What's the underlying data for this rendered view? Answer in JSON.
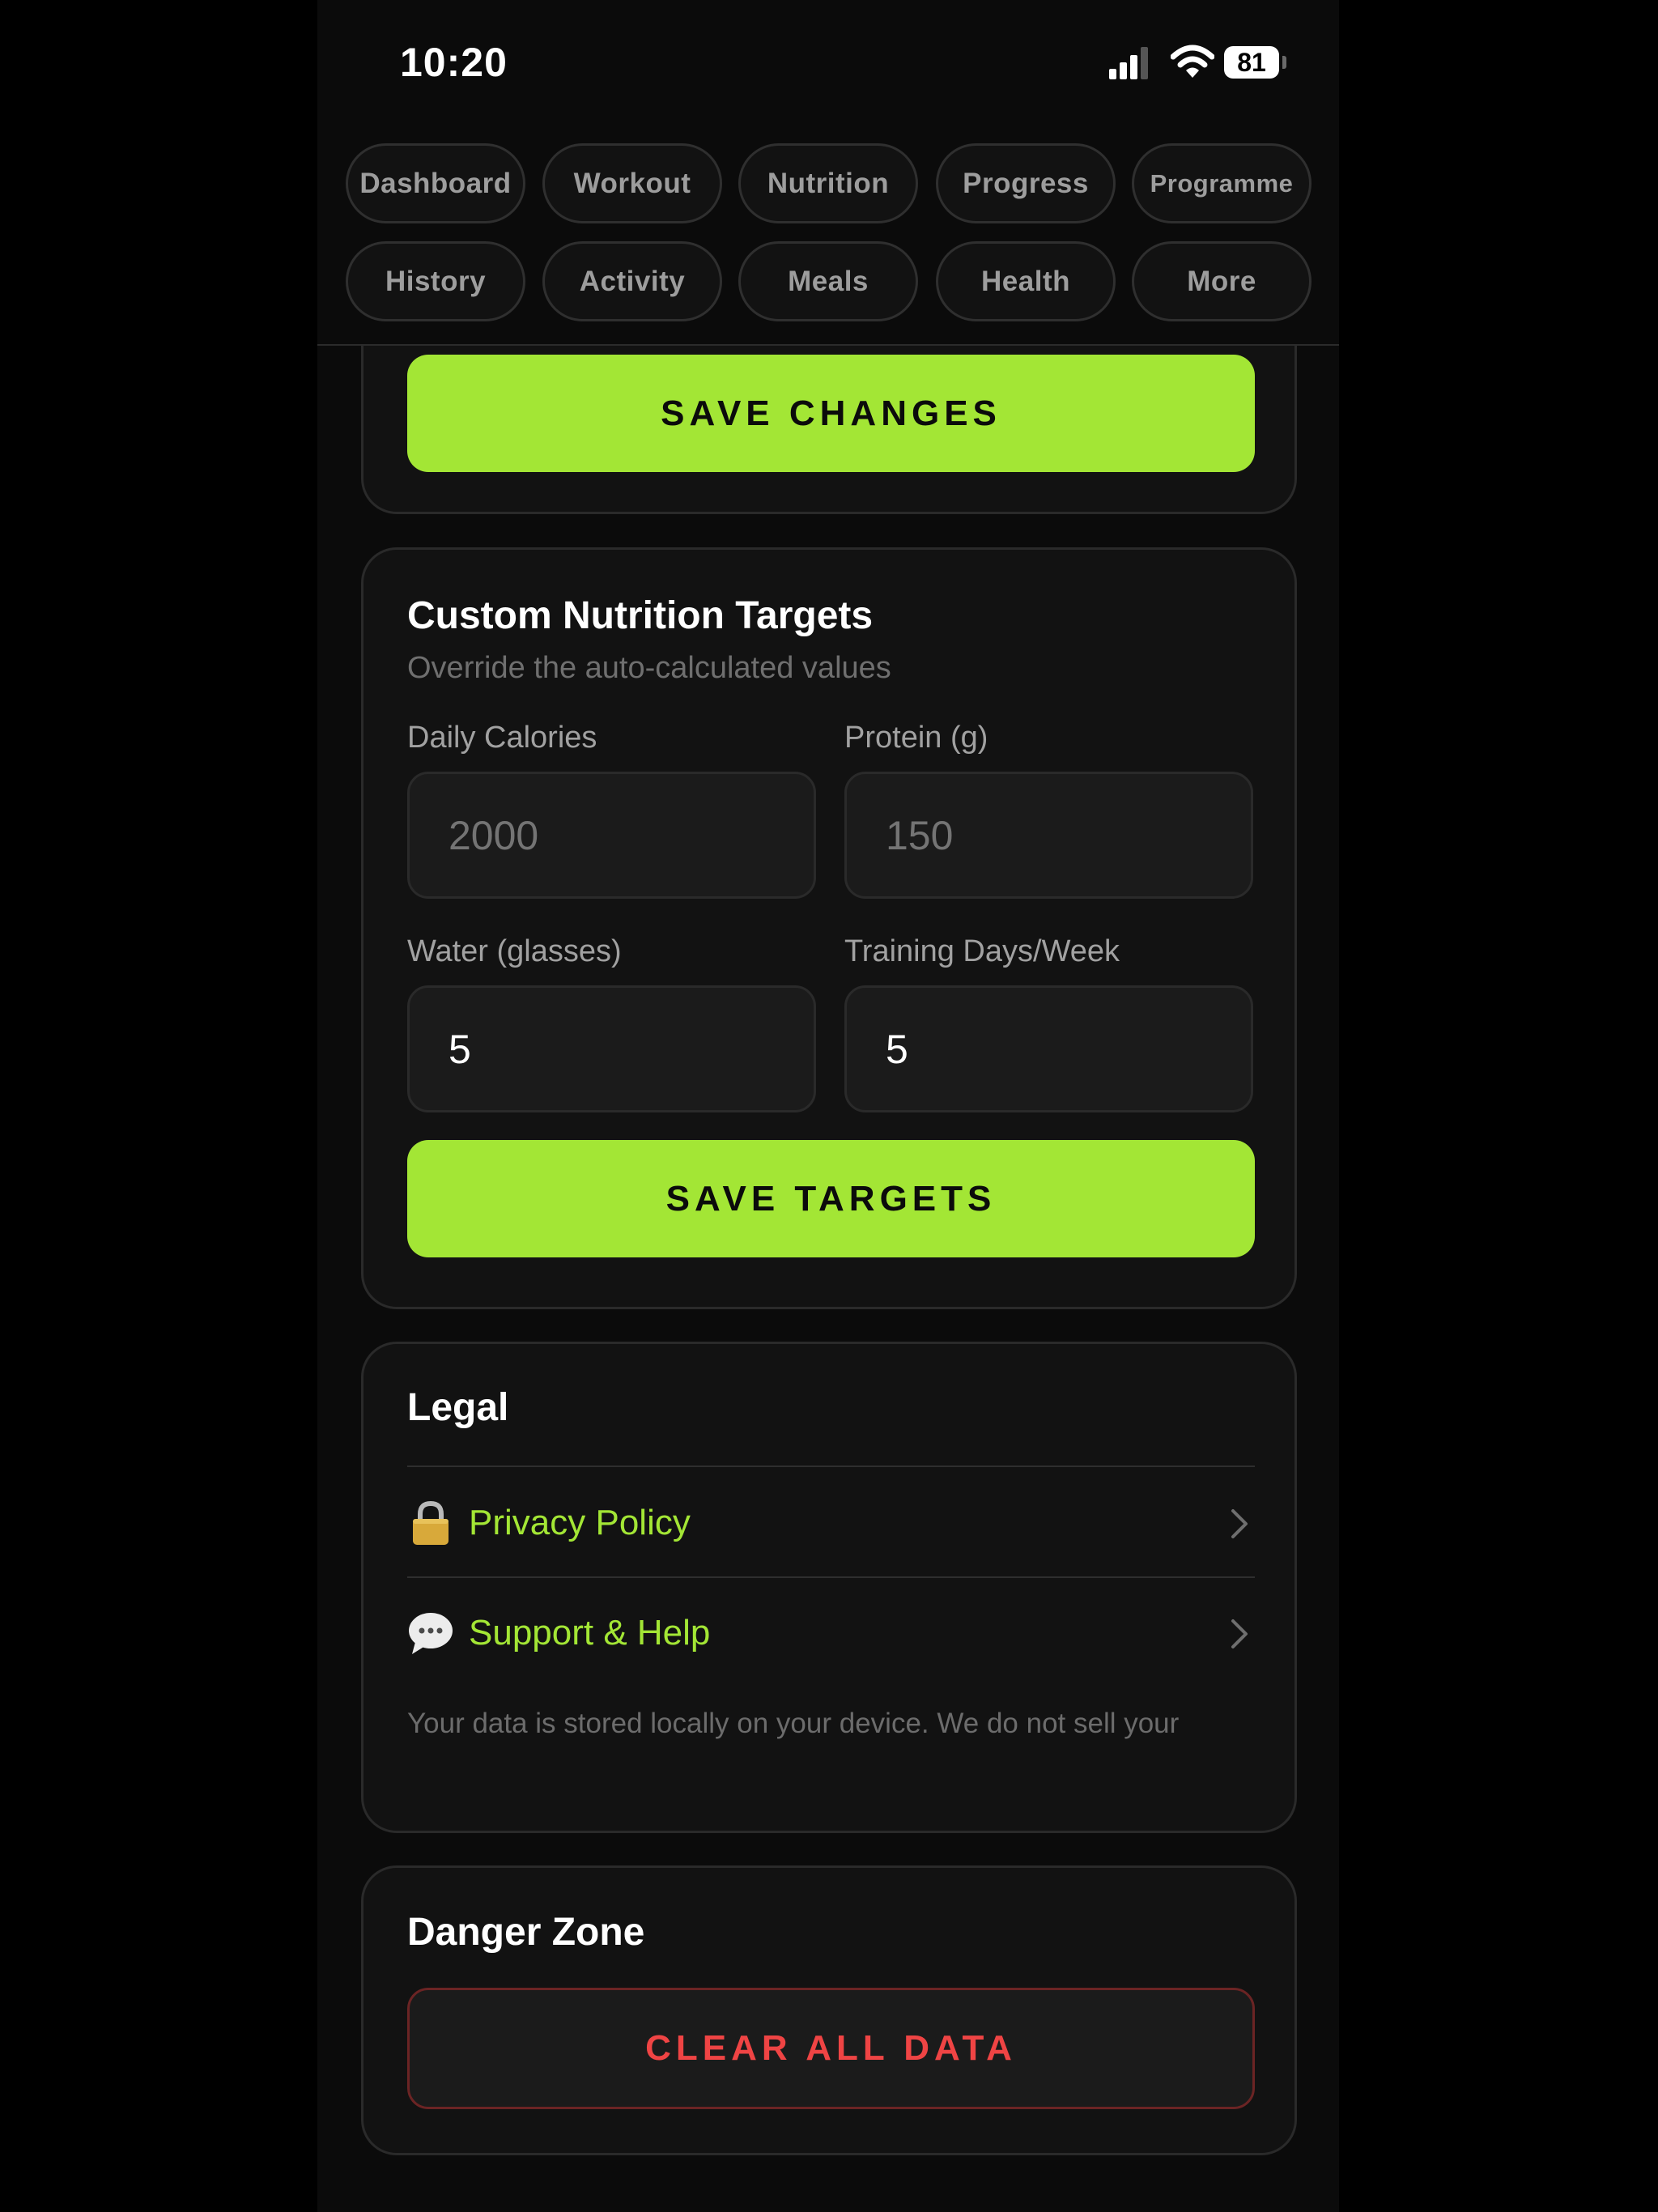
{
  "status_bar": {
    "time": "10:20",
    "battery": "81"
  },
  "nav": {
    "row1": [
      "Dashboard",
      "Workout",
      "Nutrition",
      "Progress",
      "Programme"
    ],
    "row2": [
      "History",
      "Activity",
      "Meals",
      "Health",
      "More"
    ]
  },
  "profile_card": {
    "save_label": "SAVE CHANGES"
  },
  "targets": {
    "title": "Custom Nutrition Targets",
    "subtitle": "Override the auto-calculated values",
    "calories_label": "Daily Calories",
    "calories_placeholder": "2000",
    "protein_label": "Protein (g)",
    "protein_placeholder": "150",
    "water_label": "Water (glasses)",
    "water_value": "5",
    "training_label": "Training Days/Week",
    "training_value": "5",
    "save_label": "SAVE TARGETS"
  },
  "legal": {
    "title": "Legal",
    "privacy_label": "Privacy Policy",
    "privacy_icon": "lock-icon",
    "support_label": "Support & Help",
    "support_icon": "speech-bubble-icon",
    "note": "Your data is stored locally on your device. We do not sell your"
  },
  "danger": {
    "title": "Danger Zone",
    "clear_label": "CLEAR ALL DATA"
  },
  "colors": {
    "accent": "#a3e635",
    "danger": "#ef4444",
    "background": "#0b0b0b",
    "card": "#121212"
  }
}
